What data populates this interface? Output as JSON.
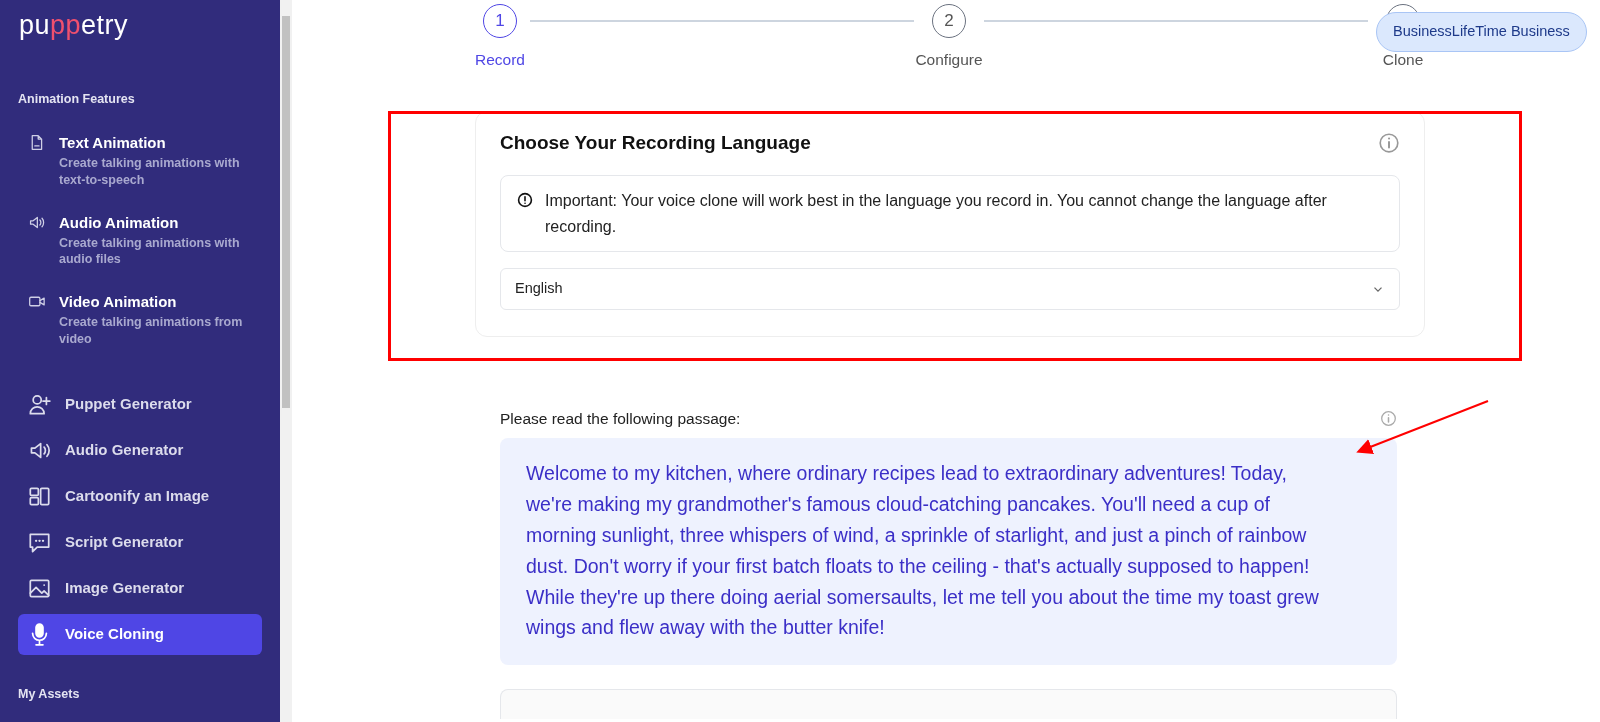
{
  "sidebar": {
    "logo": [
      {
        "text": "pu",
        "accent": false
      },
      {
        "text": "pp",
        "accent": true
      },
      {
        "text": "etry",
        "accent": false
      }
    ],
    "sections": [
      {
        "heading": "Animation Features",
        "items": [
          {
            "kind": "feature",
            "label": "Text Animation",
            "description": "Create talking animations with text-to-speech",
            "selected": false
          },
          {
            "kind": "feature",
            "label": "Audio Animation",
            "description": "Create talking animations with audio files",
            "selected": false
          },
          {
            "kind": "feature",
            "label": "Video Animation",
            "description": "Create talking animations from video",
            "selected": false
          },
          {
            "kind": "tool",
            "label": "Puppet Generator",
            "selected": false
          },
          {
            "kind": "tool",
            "label": "Audio Generator",
            "selected": false
          },
          {
            "kind": "tool",
            "label": "Cartoonify an Image",
            "selected": false
          },
          {
            "kind": "tool",
            "label": "Script Generator",
            "selected": false
          },
          {
            "kind": "tool",
            "label": "Image Generator",
            "selected": false
          },
          {
            "kind": "tool",
            "label": "Voice Cloning",
            "selected": true
          }
        ]
      },
      {
        "heading": "My Assets"
      }
    ]
  },
  "steps": [
    {
      "number": "1",
      "label": "Record",
      "selected": true
    },
    {
      "number": "2",
      "label": "Configure",
      "selected": false
    },
    {
      "label": "Clone",
      "selected": false
    }
  ],
  "plan_badge": "BusinessLifeTime Business",
  "language_card": {
    "title": "Choose Your Recording Language",
    "notice": "Important: Your voice clone will work best in the language you record in. You cannot change the language after recording.",
    "language": "English"
  },
  "passage_card": {
    "label": "Please read the following passage:",
    "passage": "Welcome to my kitchen, where ordinary recipes lead to extraordinary adventures! Today, we're making my grandmother's famous cloud-catching pancakes. You'll need a cup of morning sunlight, three whispers of wind, a sprinkle of starlight, and just a pinch of rainbow dust. Don't worry if your first batch floats to the ceiling - that's actually supposed to happen! While they're up there doing aerial somersaults, let me tell you about the time my toast grew wings and flew away with the butter knife!"
  }
}
